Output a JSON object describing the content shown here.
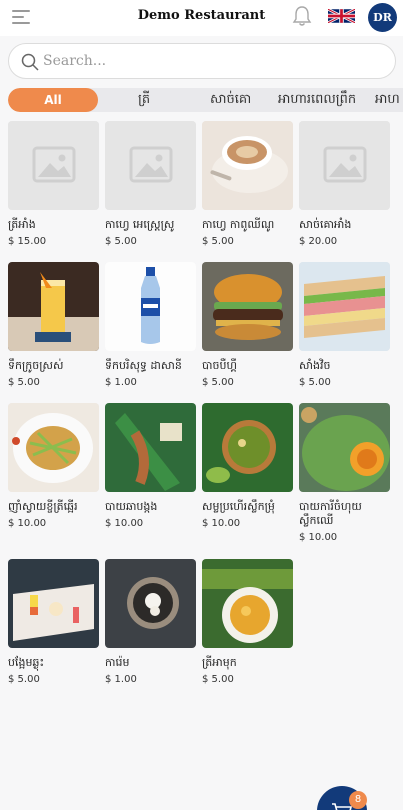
{
  "header": {
    "title": "Demo Restaurant",
    "avatar_initials": "DR",
    "menu_icon": "hamburger-icon",
    "notification_icon": "bell-icon",
    "language_icon": "uk-flag-icon"
  },
  "search": {
    "placeholder": "Search..."
  },
  "tabs": [
    {
      "label": "All",
      "active": true
    },
    {
      "label": "ត្រី"
    },
    {
      "label": "សាច់គោ"
    },
    {
      "label": "អាហារពេលព្រឹក"
    },
    {
      "label": "អាហ"
    }
  ],
  "products": [
    {
      "name": "ត្រីអាំង",
      "price": "$ 15.00",
      "image": "placeholder"
    },
    {
      "name": "កាហ្វេ អេស្រ្តេស្រូ",
      "price": "$ 5.00",
      "image": "placeholder"
    },
    {
      "name": "កាហ្វេ កាពូឈីណូ",
      "price": "$ 5.00",
      "image": "cappuccino"
    },
    {
      "name": "សាច់គោអាំង",
      "price": "$ 20.00",
      "image": "placeholder"
    },
    {
      "name": "ទឹកក្រូចស្រស់",
      "price": "$ 5.00",
      "image": "orange-juice"
    },
    {
      "name": "ទឹកបរិសុទ្ធ ដាសានី",
      "price": "$ 1.00",
      "image": "water-bottle"
    },
    {
      "name": "បាចបឺហ្គឺ",
      "price": "$ 5.00",
      "image": "burger"
    },
    {
      "name": "សាំងវិច",
      "price": "$ 5.00",
      "image": "sandwich"
    },
    {
      "name": "ញាំស្វាយខ្ចីត្រីឆ្អើរ",
      "price": "$ 10.00",
      "image": "mango-salad"
    },
    {
      "name": "បាយឆាបង្កង",
      "price": "$ 10.00",
      "image": "prawn"
    },
    {
      "name": "សម្លប្រហើរស្លឹកម្រុំ",
      "price": "$ 10.00",
      "image": "green-soup"
    },
    {
      "name": "បាយការីចំហុយស្លឹកឈើ",
      "price": "$ 10.00",
      "image": "leaf-curry"
    },
    {
      "name": "បង្អែមឆ្ងុះ",
      "price": "$ 5.00",
      "image": "skewer-dessert"
    },
    {
      "name": "ការ៉េម",
      "price": "$ 1.00",
      "image": "ice-cream"
    },
    {
      "name": "ត្រីអាមុក",
      "price": "$ 5.00",
      "image": "amok"
    }
  ],
  "cart": {
    "count": "8",
    "icon": "cart-icon"
  },
  "colors": {
    "accent": "#ef8a4c",
    "brand": "#123a7a"
  }
}
